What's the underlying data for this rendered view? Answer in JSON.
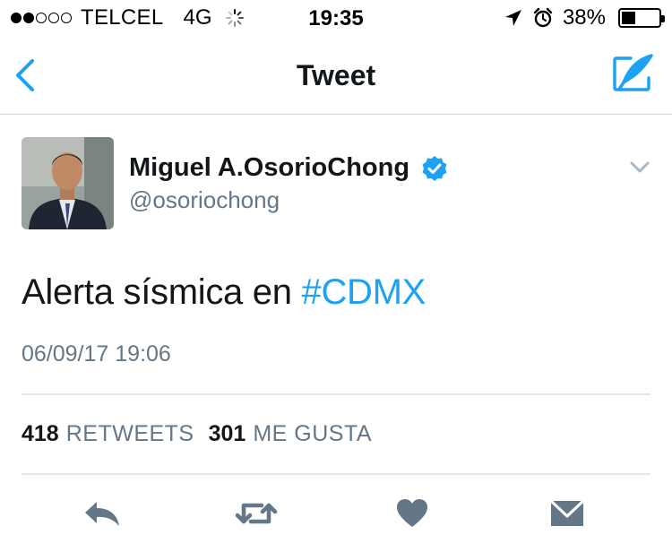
{
  "status_bar": {
    "carrier": "TELCEL",
    "network": "4G",
    "time": "19:35",
    "battery_percent": "38%",
    "battery_level": 0.38,
    "signal_bars": 2,
    "signal_total": 5
  },
  "nav": {
    "title": "Tweet",
    "back_icon": "chevron-left-icon",
    "compose_icon": "compose-icon"
  },
  "tweet": {
    "author_name": "Miguel A.OsorioChong",
    "handle": "@osoriochong",
    "text_prefix": "Alerta sísmica en ",
    "hashtag": "#CDMX",
    "timestamp": "06/09/17 19:06",
    "retweets_count": "418",
    "retweets_label": "RETWEETS",
    "likes_count": "301",
    "likes_label": "ME GUSTA"
  },
  "colors": {
    "accent": "#1da1f2",
    "secondary_text": "#657786",
    "action_icon": "#657786"
  },
  "actions": [
    "reply-icon",
    "retweet-icon",
    "heart-icon",
    "message-icon"
  ]
}
